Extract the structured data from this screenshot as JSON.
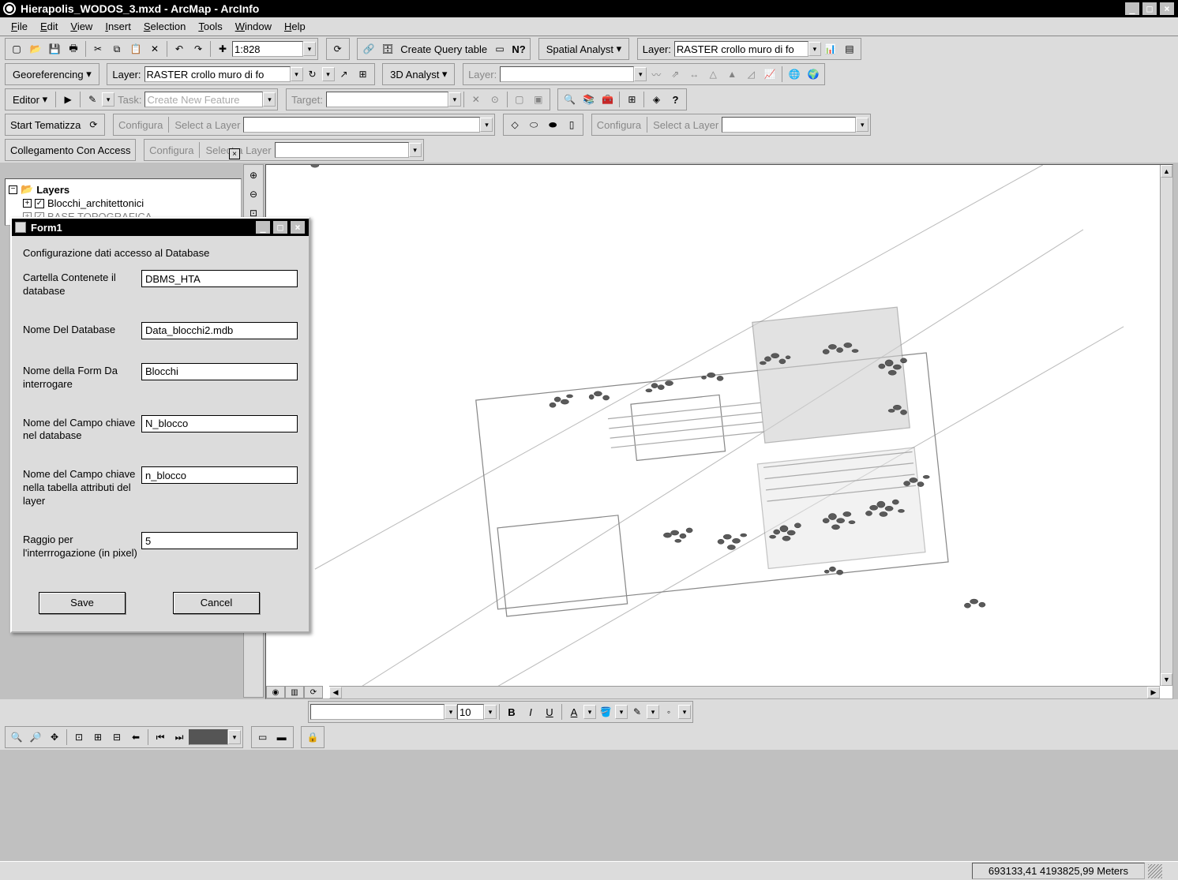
{
  "title": "Hierapolis_WODOS_3.mxd - ArcMap - ArcInfo",
  "menu": [
    "File",
    "Edit",
    "View",
    "Insert",
    "Selection",
    "Tools",
    "Window",
    "Help"
  ],
  "toolbar1": {
    "scale": "1:828"
  },
  "query_label": "Create Query table",
  "spatial_analyst": "Spatial Analyst",
  "layer_label": "Layer:",
  "layer1_value": "RASTER crollo muro di fo",
  "georef_label": "Georeferencing",
  "layer2_value": "RASTER crollo muro di fo",
  "analyst3d": "3D Analyst",
  "layer3_value": "",
  "editor_label": "Editor",
  "task_label": "Task:",
  "task_value": "Create New Feature",
  "target_label": "Target:",
  "target_value": "",
  "start_tematizza": "Start Tematizza",
  "configura": "Configura",
  "select_layer": "Select a Layer",
  "collegamento": "Collegamento Con Access",
  "toc": {
    "root": "Layers",
    "items": [
      "Blocchi_architettonici",
      "BASE TOPOGRAFICA"
    ]
  },
  "dialog": {
    "title": "Form1",
    "subtitle": "Configurazione dati accesso al Database",
    "fields": [
      {
        "label": "Cartella Contenete il database",
        "value": "DBMS_HTA"
      },
      {
        "label": "Nome Del Database",
        "value": "Data_blocchi2.mdb"
      },
      {
        "label": "Nome della Form Da interrogare",
        "value": "Blocchi"
      },
      {
        "label": "Nome del Campo chiave nel database",
        "value": "N_blocco"
      },
      {
        "label": "Nome del Campo chiave nella tabella attributi del layer",
        "value": "n_blocco"
      },
      {
        "label": "Raggio per l'interrrogazione (in pixel)",
        "value": "5"
      }
    ],
    "save": "Save",
    "cancel": "Cancel"
  },
  "format_size": "10",
  "status_coord": "693133,41 4193825,99 Meters"
}
